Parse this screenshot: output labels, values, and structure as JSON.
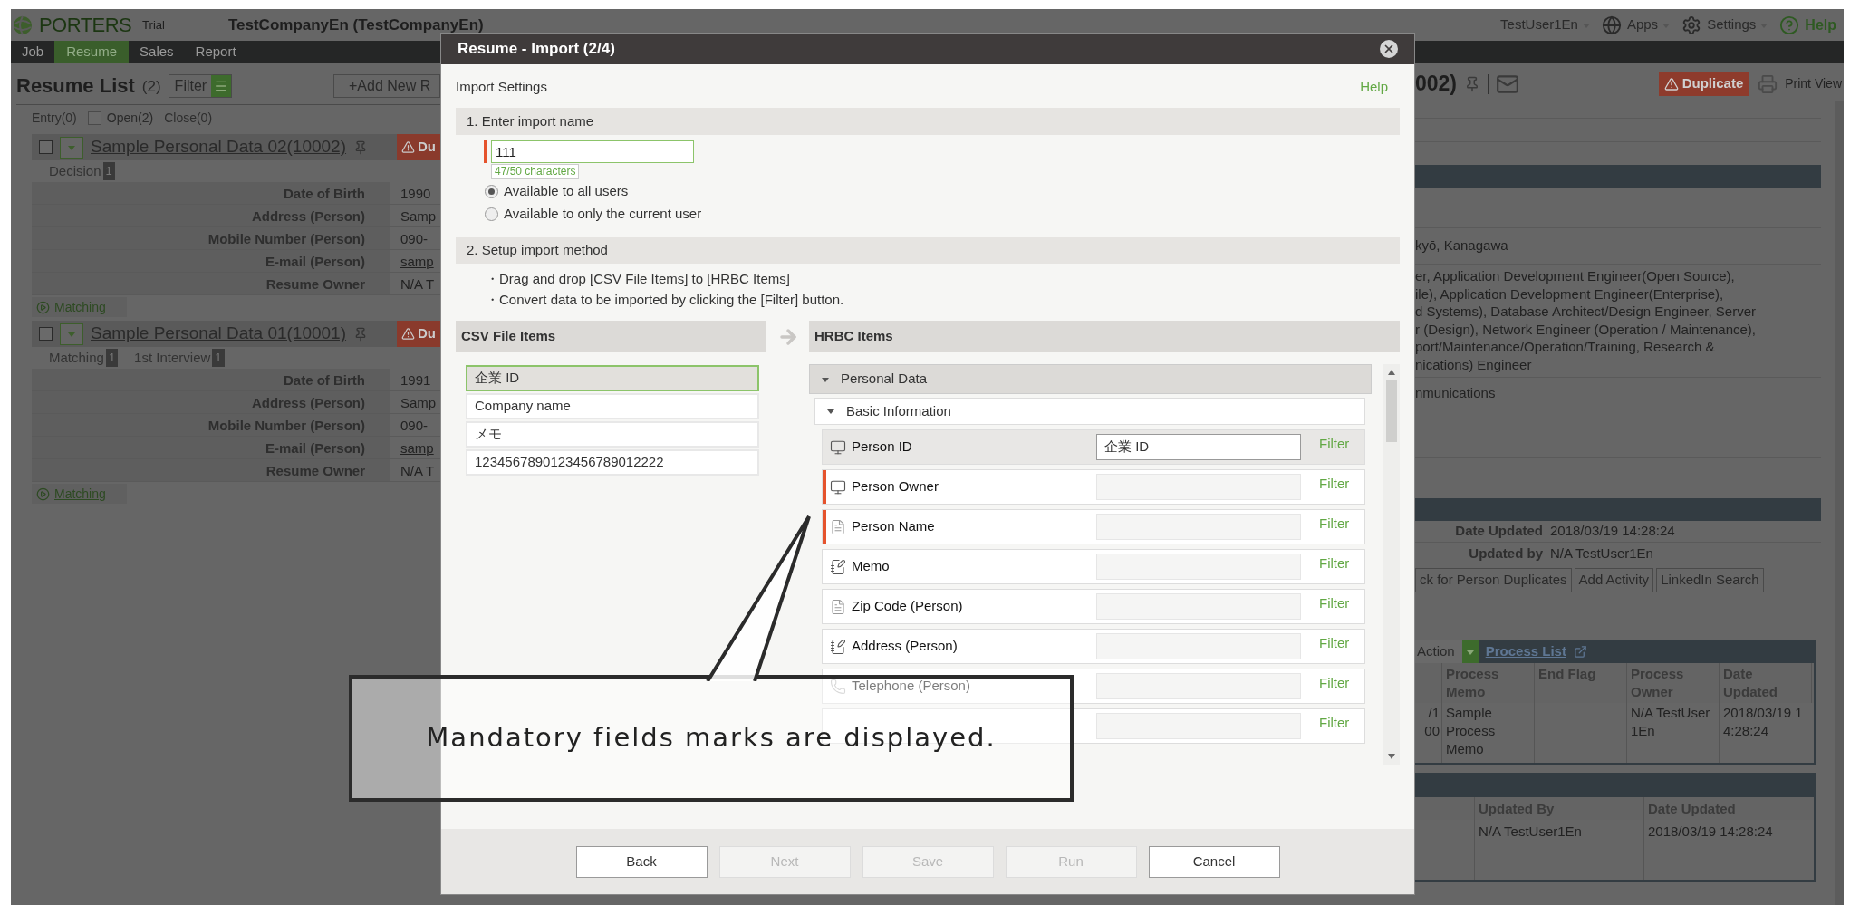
{
  "header": {
    "logo": "PORTERS",
    "edition": "Trial",
    "company": "TestCompanyEn (TestCompanyEn)",
    "user": "TestUser1En",
    "apps": "Apps",
    "settings": "Settings",
    "help": "Help"
  },
  "nav": [
    {
      "label": "Job",
      "selected": false
    },
    {
      "label": "Resume",
      "selected": true
    },
    {
      "label": "Sales",
      "selected": false
    },
    {
      "label": "Report",
      "selected": false
    }
  ],
  "resume_list": {
    "title": "Resume List",
    "count": "(2)",
    "filter": "Filter",
    "add_new": "+Add New R",
    "statuses": [
      {
        "label": "Entry(0)",
        "kind": "text"
      },
      {
        "label": "Open(2)",
        "kind": "checkbox",
        "checked": false
      },
      {
        "label": "Close(0)",
        "kind": "text"
      }
    ],
    "records": [
      {
        "name": "Sample Personal Data 02(10002)",
        "checked": false,
        "badge": "Du",
        "tags": [
          {
            "label": "Decision",
            "count": "1"
          }
        ],
        "fields": [
          {
            "label": "Date of Birth",
            "value": "1990",
            "kind": "text"
          },
          {
            "label": "Address (Person)",
            "value": "Samp",
            "kind": "text"
          },
          {
            "label": "Mobile Number (Person)",
            "value": "090-",
            "kind": "text"
          },
          {
            "label": "E-mail (Person)",
            "value": "samp",
            "kind": "link"
          },
          {
            "label": "Resume Owner",
            "value": "N/A T",
            "kind": "text"
          }
        ],
        "link": "Matching"
      },
      {
        "name": "Sample Personal Data 01(10001)",
        "checked": false,
        "badge": "Du",
        "tags": [
          {
            "label": "Matching",
            "count": "1"
          },
          {
            "label": "1st Interview",
            "count": "1"
          }
        ],
        "fields": [
          {
            "label": "Date of Birth",
            "value": "1991",
            "kind": "text"
          },
          {
            "label": "Address (Person)",
            "value": "Samp",
            "kind": "text"
          },
          {
            "label": "Mobile Number (Person)",
            "value": "090-",
            "kind": "text"
          },
          {
            "label": "E-mail (Person)",
            "value": "samp",
            "kind": "link"
          },
          {
            "label": "Resume Owner",
            "value": "N/A T",
            "kind": "text"
          }
        ],
        "link": "Matching"
      }
    ]
  },
  "detail": {
    "title": "002)",
    "duplicate": "Duplicate",
    "print": "Print View",
    "address": "kyō, Kanagawa",
    "occupations": [
      "er, Application Development Engineer(Open Source),",
      "ile), Application Development Engineer(Enterprise),",
      "d Systems), Database Architect/Design Engineer, Server",
      "r (Design), Network Engineer (Operation / Maintenance),",
      "port/Maintenance/Operation/Training, Research &",
      "nications) Engineer"
    ],
    "category": "nmunications",
    "meta": [
      {
        "label": "Date Updated",
        "value": "2018/03/19 14:28:24"
      },
      {
        "label": "Updated by",
        "value": "N/A TestUser1En"
      }
    ],
    "actions": [
      "ck for Person Duplicates",
      "Add Activity",
      "LinkedIn Search"
    ],
    "process": {
      "action": "Action",
      "link": "Process List",
      "columns": [
        "Process Memo",
        "End Flag",
        "Process Owner",
        "Date Updated"
      ],
      "rows": [
        {
          "lead": [
            "/1",
            "00"
          ],
          "memo": "Sample Process Memo",
          "owner": "N/A TestUser1En",
          "updated": "2018/03/19 14:28:24"
        }
      ]
    },
    "history": {
      "columns": [
        "Updated By",
        "Date Updated"
      ],
      "rows": [
        {
          "cells": [
            "N/A TestUser1En",
            "2018/03/19 14:28:24"
          ]
        }
      ]
    }
  },
  "dialog": {
    "title": "Resume - Import (2/4)",
    "heading": "Import Settings",
    "help": "Help",
    "step1": "1. Enter import name",
    "import_name": {
      "value": "111",
      "required": true,
      "counter": "47/50 characters"
    },
    "visibility": [
      {
        "label": "Available to all users",
        "selected": true
      },
      {
        "label": "Available to only the current user",
        "selected": false
      }
    ],
    "step2": "2. Setup import method",
    "instructions": [
      "・Drag and drop [CSV File Items] to [HRBC Items]",
      "・Convert data to be imported by clicking the [Filter] button."
    ],
    "csv_header": "CSV File Items",
    "hrbc_header": "HRBC Items",
    "csv_items": [
      {
        "label": "企業 ID",
        "selected": true
      },
      {
        "label": "Company name",
        "selected": false
      },
      {
        "label": "メモ",
        "selected": false
      },
      {
        "label": "1234567890123456789012222",
        "selected": false
      }
    ],
    "group": {
      "label": "Personal Data",
      "expanded": true
    },
    "subgroup": {
      "label": "Basic Information",
      "expanded": true
    },
    "fields": [
      {
        "label": "Person ID",
        "kind": "system",
        "selected": true,
        "required": false,
        "mapped": "企業 ID",
        "filter": "Filter"
      },
      {
        "label": "Person Owner",
        "kind": "system",
        "selected": false,
        "required": true,
        "filter": "Filter"
      },
      {
        "label": "Person Name",
        "kind": "text",
        "selected": false,
        "required": true,
        "filter": "Filter"
      },
      {
        "label": "Memo",
        "kind": "richtext",
        "selected": false,
        "required": false,
        "filter": "Filter"
      },
      {
        "label": "Zip Code (Person)",
        "kind": "text",
        "selected": false,
        "required": false,
        "filter": "Filter"
      },
      {
        "label": "Address (Person)",
        "kind": "richtext",
        "selected": false,
        "required": false,
        "filter": "Filter"
      },
      {
        "label": "Telephone (Person)",
        "kind": "phone",
        "selected": false,
        "required": false,
        "filter": "Filter"
      },
      {
        "selected": false,
        "required": false,
        "filter": "Filter"
      }
    ],
    "buttons": [
      {
        "label": "Back",
        "disabled": false
      },
      {
        "label": "Next",
        "disabled": true
      },
      {
        "label": "Save",
        "disabled": true
      },
      {
        "label": "Run",
        "disabled": true
      },
      {
        "label": "Cancel",
        "disabled": false
      }
    ]
  },
  "callout": {
    "text": "Mandatory fields marks are displayed."
  }
}
